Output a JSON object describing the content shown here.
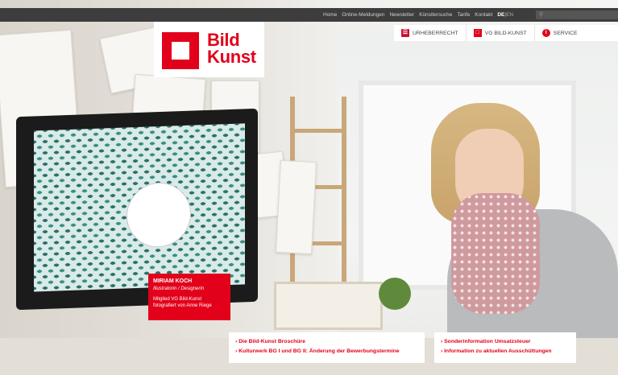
{
  "topnav": {
    "links": [
      "Home",
      "Online-Meldungen",
      "Newsletter",
      "Künstlersuche",
      "Tarife",
      "Kontakt"
    ],
    "lang_active": "DE",
    "lang_sep": "|",
    "lang_other": "EN"
  },
  "search": {
    "placeholder": "",
    "icon": "search-icon"
  },
  "subnav": [
    {
      "label": "URHEBERRECHT",
      "icon": "book-icon"
    },
    {
      "label": "VG BILD-KUNST",
      "icon": "logo-square-icon"
    },
    {
      "label": "SERVICE",
      "icon": "info-icon"
    }
  ],
  "logo": {
    "line1": "Bild",
    "line2": "Kunst"
  },
  "caption": {
    "name": "MIRIAM KOCH",
    "role": "Illustratorin / Designerin",
    "member": "Mitglied VG Bild-Kunst",
    "photo": "fotografiert von Anne Riege"
  },
  "links_left": [
    "› Die Bild-Kunst Broschüre",
    "› Kulturwerk BG I und BG II: Änderung der Bewerbungstermine"
  ],
  "links_right": [
    "› Sonderinformation Umsatzsteuer",
    "› Information zu aktuellen Ausschüttungen"
  ],
  "colors": {
    "brand": "#e2001a",
    "topbar": "#3d3d3d"
  }
}
